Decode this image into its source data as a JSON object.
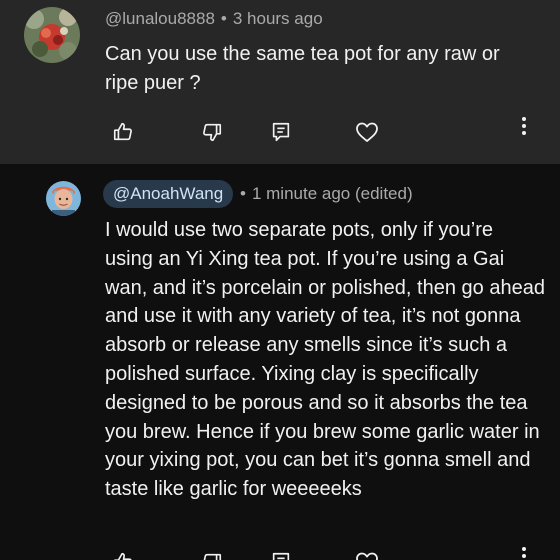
{
  "comment": {
    "author": "@lunalou8888",
    "separator": "•",
    "time": "3 hours ago",
    "text": "Can you use the same tea pot for any raw or ripe puer ?"
  },
  "reply": {
    "author": "@AnoahWang",
    "separator": "•",
    "time": "1 minute ago (edited)",
    "text": "I would use two separate pots, only if you’re using an Yi Xing tea pot. If you’re using a Gai wan, and it’s porcelain or polished, then go ahead and use it with any variety of tea, it’s not gonna absorb or release any smells since it’s such a polished surface. Yixing clay is specifically designed to be porous and so it absorbs the tea you brew. Hence if you brew some garlic water in your yixing pot, you can bet it’s gonna smell and taste like garlic for weeeeeks"
  },
  "icons": {
    "like": "thumbs-up-icon",
    "dislike": "thumbs-down-icon",
    "reply": "comment-icon",
    "heart": "heart-icon",
    "more": "more-vertical-icon"
  },
  "colors": {
    "top_background": "#272727",
    "reply_background": "#0f0f0f",
    "handle_chip": "#27394a",
    "meta_text": "#aaaaaa"
  }
}
